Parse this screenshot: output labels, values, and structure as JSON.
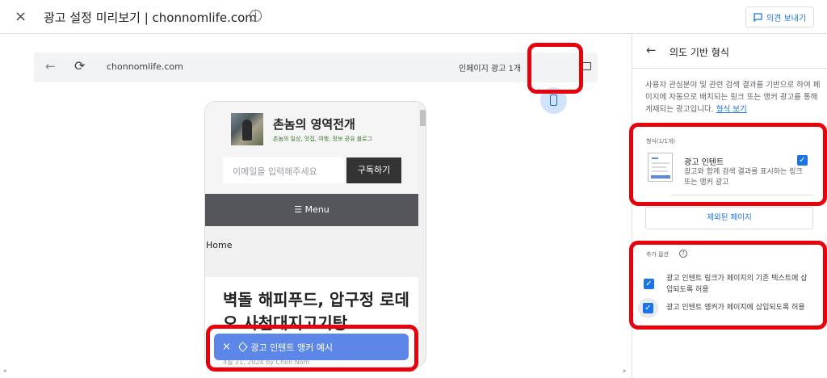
{
  "header": {
    "close_icon": "×",
    "title": "광고 설정 미리보기 | chonnomlife.com",
    "info_icon": "i",
    "feedback_label": "의견 보내기"
  },
  "browser": {
    "url": "chonnomlife.com",
    "ad_count": "인페이지 광고 1개"
  },
  "site": {
    "blog_title": "촌놈의 영역전개",
    "blog_subtitle": "촌놈의 일상, 맛집, 여행, 정보 공유 블로그",
    "email_placeholder": "이메일을 입력해주세요",
    "subscribe_label": "구독하기",
    "menu_label": "☰  Menu",
    "breadcrumb": "Home",
    "headline": "벽돌 해피푸드, 압구정 로데오 사천대지고기탕",
    "meta_line": "4월 21, 2024 by Chon Nom"
  },
  "ad_bar": {
    "close": "×",
    "label": "광고 인텐트 앵커 예시"
  },
  "panel": {
    "title": "의도 기반 형식",
    "description": "사용자 관심분야 및 관련 검색 결과를 기반으로 하여 페이지에 자동으로 배치되는 링크 또는 앵커 광고를 통해 게재되는 광고입니다.",
    "description_link": "형식 보기",
    "format_section": "형식(1/1개)",
    "format_card_title": "광고 인텐트",
    "format_card_desc": "광고와 함께 검색 결과를 표시하는 링크 또는 앵커 광고",
    "excluded_pages": "제외된 페이지",
    "extra_options": "추가 옵션",
    "option1": "광고 인텐트 링크가 페이지의 기존 텍스트에 삽입되도록 허용",
    "option2": "광고 인텐트 앵커가 페이지에 삽입되도록 허용"
  },
  "colors": {
    "accent": "#1a73e8",
    "highlight": "#e8000b",
    "ad_bar": "#5c86e8"
  }
}
